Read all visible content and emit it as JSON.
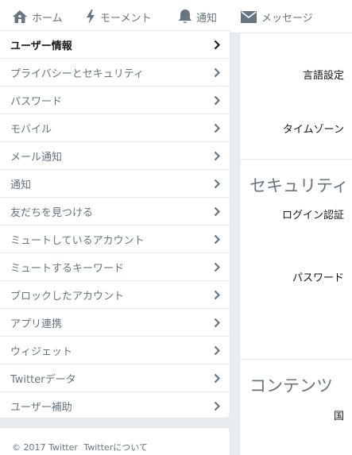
{
  "nav": {
    "home": "ホーム",
    "moments": "モーメント",
    "notifications": "通知",
    "messages": "メッセージ"
  },
  "menu": {
    "items": [
      {
        "label": "ユーザー情報",
        "active": true
      },
      {
        "label": "プライバシーとセキュリティ"
      },
      {
        "label": "パスワード"
      },
      {
        "label": "モバイル"
      },
      {
        "label": "メール通知"
      },
      {
        "label": "通知"
      },
      {
        "label": "友だちを見つける"
      },
      {
        "label": "ミュートしているアカウント"
      },
      {
        "label": "ミュートするキーワード"
      },
      {
        "label": "ブロックしたアカウント"
      },
      {
        "label": "アプリ連携"
      },
      {
        "label": "ウィジェット"
      },
      {
        "label": "Twitterデータ"
      },
      {
        "label": "ユーザー補助"
      }
    ]
  },
  "footer": {
    "copyright": "© 2017 Twitter",
    "about": "Twitterについて"
  },
  "content": {
    "language_label": "言語設定",
    "timezone_label": "タイムゾーン",
    "security_title": "セキュリティ",
    "login_verification_label": "ログイン認証",
    "password_label": "パスワード",
    "content_title": "コンテンツ",
    "country_label": "国"
  },
  "colors": {
    "background": "#e6ecf0",
    "nav_text": "#66757f",
    "icon": "#66757f",
    "active_text": "#14171a"
  },
  "icons": {
    "home": "home-icon",
    "moments": "lightning-icon",
    "notifications": "bell-icon",
    "messages": "envelope-icon",
    "chevron": "chevron-right-icon"
  }
}
